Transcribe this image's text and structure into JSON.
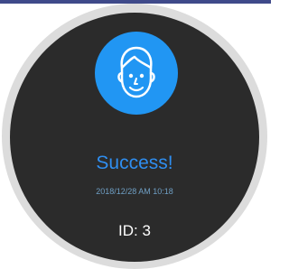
{
  "result": {
    "status": "Success!",
    "timestamp": "2018/12/28 AM 10:18",
    "id_label": "ID: 3"
  },
  "avatar": {
    "icon": "face-icon",
    "background_color": "#2196f3"
  },
  "colors": {
    "screen": "#2b2b2b",
    "bezel": "#dcdcdc",
    "status_text": "#2f8ef0",
    "timestamp_text": "#6f9fc4",
    "id_text": "#ffffff"
  }
}
